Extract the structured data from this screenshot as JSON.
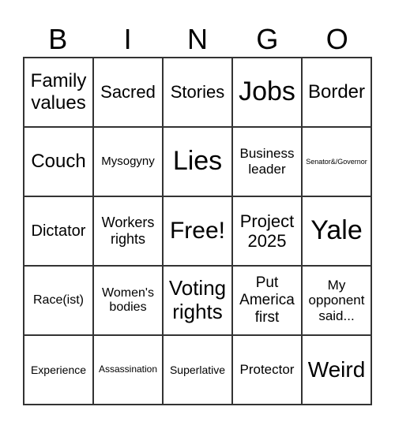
{
  "header": {
    "letters": [
      "B",
      "I",
      "N",
      "G",
      "O"
    ]
  },
  "cells": [
    "Family values",
    "Sacred",
    "Stories",
    "Jobs",
    "Border",
    "Couch",
    "Mysogyny",
    "Lies",
    "Business leader",
    "Senator&/Governor",
    "Dictator",
    "Workers rights",
    "Free!",
    "Project 2025",
    "Yale",
    "Race(ist)",
    "Women's bodies",
    "Voting rights",
    "Put America first",
    "My opponent said...",
    "Experience",
    "Assassination",
    "Superlative",
    "Protector",
    "Weird"
  ]
}
